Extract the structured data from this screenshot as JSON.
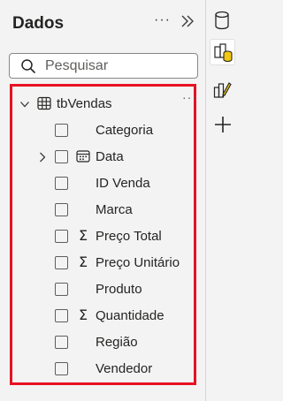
{
  "pane": {
    "title": "Dados",
    "more_label": "···",
    "search": {
      "placeholder": "Pesquisar",
      "value": ""
    }
  },
  "table": {
    "name": "tbVendas",
    "more_label": "···",
    "fields": [
      {
        "label": "Categoria",
        "type": "none",
        "expandable": false
      },
      {
        "label": "Data",
        "type": "calendar",
        "expandable": true
      },
      {
        "label": "ID Venda",
        "type": "none",
        "expandable": false
      },
      {
        "label": "Marca",
        "type": "none",
        "expandable": false
      },
      {
        "label": "Preço Total",
        "type": "sigma",
        "expandable": false
      },
      {
        "label": "Preço Unitário",
        "type": "sigma",
        "expandable": false
      },
      {
        "label": "Produto",
        "type": "none",
        "expandable": false
      },
      {
        "label": "Quantidade",
        "type": "sigma",
        "expandable": false
      },
      {
        "label": "Região",
        "type": "none",
        "expandable": false
      },
      {
        "label": "Vendedor",
        "type": "none",
        "expandable": false
      }
    ]
  },
  "rail": {
    "icons": [
      "data-cylinder-icon",
      "build-visual-icon",
      "format-visual-icon",
      "add-icon"
    ]
  },
  "colors": {
    "highlight_border": "#e81123",
    "text": "#252423",
    "background": "#f3f3f3"
  }
}
